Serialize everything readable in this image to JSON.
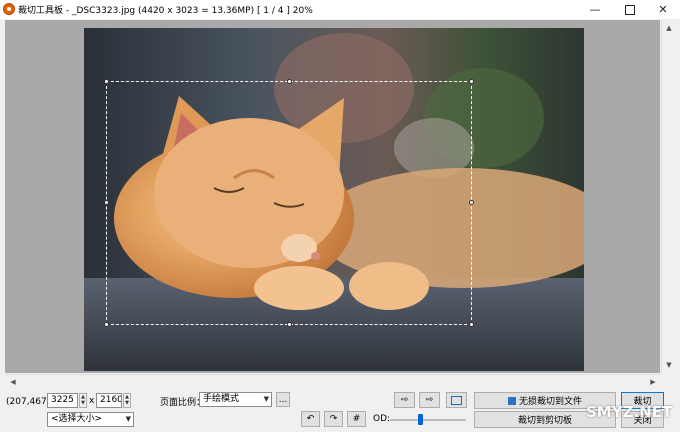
{
  "window": {
    "app_title": "裁切工具板",
    "file_info": "- _DSC3323.jpg  (4420 x 3023 = 13.36MP)  [ 1 / 4 ]  20%"
  },
  "status": {
    "coordinates": "(207,467)"
  },
  "size": {
    "width": "3225",
    "times": "x",
    "height": "2160",
    "preset": "<选择大小>"
  },
  "ratio": {
    "label": "页面比例：",
    "mode": "手绘模式",
    "more": "..."
  },
  "od": {
    "label": "OD:",
    "level": 0.4
  },
  "actions": {
    "lossless_crop": "无损裁切到文件",
    "crop_to_clipboard": "裁切到剪切板",
    "crop": "裁切",
    "close": "关闭"
  },
  "watermark": "SMYZ.NET"
}
